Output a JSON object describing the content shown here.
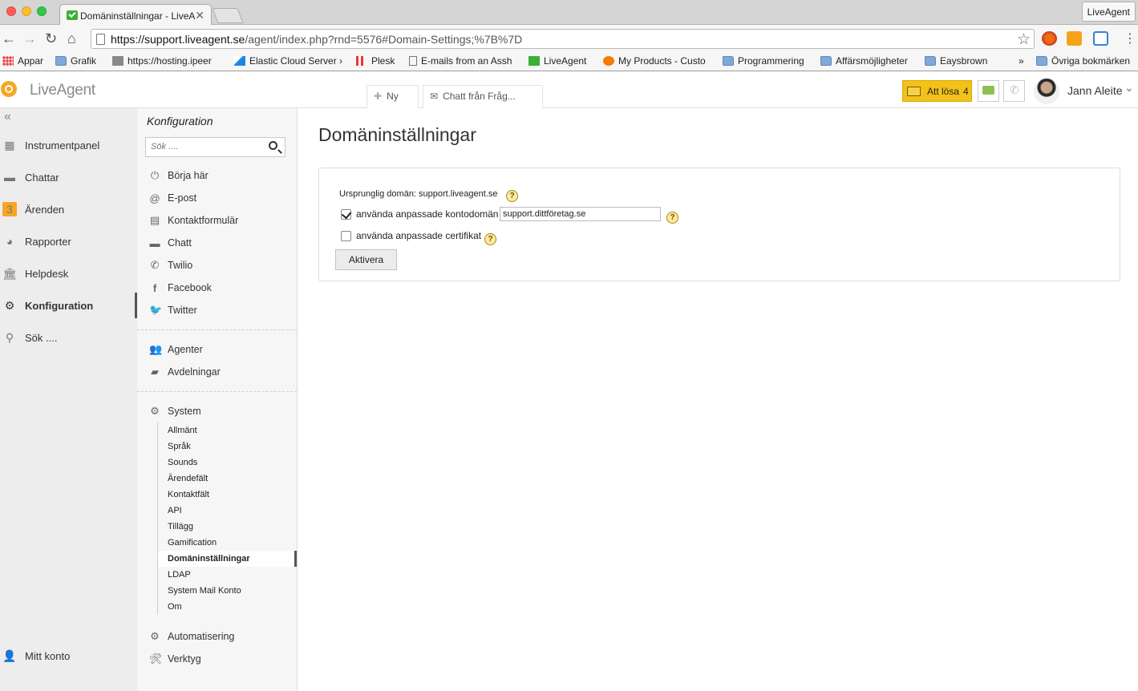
{
  "browser": {
    "tab_title": "Domäninställningar - LiveA",
    "tab_close": "✕",
    "profile": "LiveAgent",
    "url_host": "https://support.liveagent.se",
    "url_path": "/agent/index.php?rnd=5576#Domain-Settings;%7B%7D",
    "bookmarks": [
      {
        "label": "Appar"
      },
      {
        "label": "Grafik"
      },
      {
        "label": "https://hosting.ipeer"
      },
      {
        "label": "Elastic Cloud Server ›"
      },
      {
        "label": "Plesk"
      },
      {
        "label": "E-mails from an Assh"
      },
      {
        "label": "LiveAgent"
      },
      {
        "label": "My Products - Custo"
      },
      {
        "label": "Programmering"
      },
      {
        "label": "Affärsmöjligheter"
      },
      {
        "label": "Eaysbrown"
      },
      {
        "label": "»"
      },
      {
        "label": "Övriga bokmärken"
      }
    ]
  },
  "header": {
    "logo": "LiveAgent",
    "new_button": "Ny",
    "chat_button": "Chatt från Fråg...",
    "todo_label": "Att lösa",
    "todo_count": "4",
    "user_name": "Jann Aleite"
  },
  "leftnav": {
    "items": [
      {
        "label": "Instrumentpanel"
      },
      {
        "label": "Chattar"
      },
      {
        "label": "Ärenden",
        "badge": "3"
      },
      {
        "label": "Rapporter"
      },
      {
        "label": "Helpdesk"
      },
      {
        "label": "Konfiguration"
      },
      {
        "label": "Sök ...."
      }
    ],
    "account": "Mitt konto"
  },
  "midpanel": {
    "title": "Konfiguration",
    "search_placeholder": "Sök ....",
    "group1": [
      "Börja här",
      "E-post",
      "Kontaktformulär",
      "Chatt",
      "Twilio",
      "Facebook",
      "Twitter"
    ],
    "group2": [
      "Agenter",
      "Avdelningar"
    ],
    "system": "System",
    "system_items": [
      "Allmänt",
      "Språk",
      "Sounds",
      "Ärendefält",
      "Kontaktfält",
      "API",
      "Tillägg",
      "Gamification",
      "Domäninställningar",
      "LDAP",
      "System Mail Konto",
      "Om"
    ],
    "automation": "Automatisering",
    "tools": "Verktyg"
  },
  "content": {
    "title": "Domäninställningar",
    "original_domain": "Ursprunglig domän: support.liveagent.se",
    "custom_domain_label": "använda anpassade kontodomän",
    "custom_domain_checked": true,
    "custom_domain_value": "support.dittföretag.se",
    "custom_cert_label": "använda anpassade certifikat",
    "custom_cert_checked": false,
    "help_glyph": "?",
    "activate_button": "Aktivera"
  }
}
